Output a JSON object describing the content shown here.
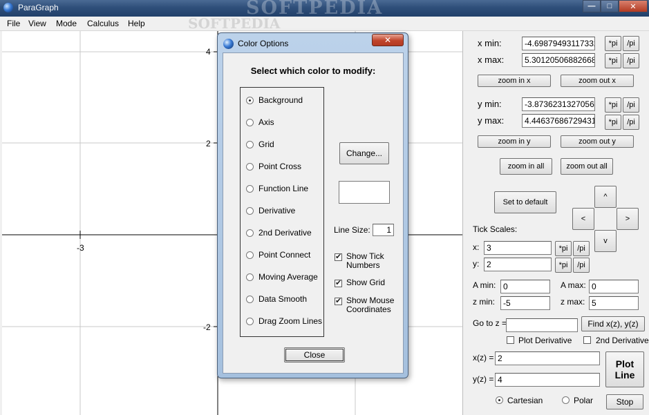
{
  "window": {
    "title": "ParaGraph",
    "watermark": "SOFTPEDIA",
    "controls": {
      "minimize": "—",
      "maximize": "□",
      "close": "✕"
    }
  },
  "menu": [
    "File",
    "View",
    "Mode",
    "Calculus",
    "Help"
  ],
  "menu_watermark": "SOFTPEDIA",
  "graph": {
    "x_tick_labels": [
      "-3"
    ],
    "y_tick_labels": [
      "4",
      "2",
      "-2"
    ]
  },
  "panel": {
    "xmin_label": "x min:",
    "xmin_value": "-4.69879493117332",
    "xmax_label": "x max:",
    "xmax_value": "5.30120506882668",
    "ymin_label": "y min:",
    "ymin_value": "-3.87362313270569",
    "ymax_label": "y max:",
    "ymax_value": "4.44637686729431",
    "times_pi": "*pi",
    "div_pi": "/pi",
    "zoom_in_x": "zoom in x",
    "zoom_out_x": "zoom out x",
    "zoom_in_y": "zoom in y",
    "zoom_out_y": "zoom out y",
    "zoom_in_all": "zoom in all",
    "zoom_out_all": "zoom out all",
    "set_default": "Set to default",
    "arrow_up": "^",
    "arrow_left": "<",
    "arrow_right": ">",
    "arrow_down": "v",
    "tick_scales_label": "Tick Scales:",
    "tick_x_label": "x:",
    "tick_x_value": "3",
    "tick_y_label": "y:",
    "tick_y_value": "2",
    "amin_label": "A min:",
    "amin_value": "0",
    "amax_label": "A max:",
    "amax_value": "0",
    "zmin_label": "z min:",
    "zmin_value": "-5",
    "zmax_label": "z max:",
    "zmax_value": "5",
    "goto_label": "Go to z =",
    "goto_value": "",
    "find_button": "Find x(z), y(z)",
    "plot_derivative": "Plot Derivative",
    "second_derivative": "2nd Derivative",
    "xz_label": "x(z) =",
    "xz_value": "2",
    "yz_label": "y(z) =",
    "yz_value": "4",
    "plot_line_1": "Plot",
    "plot_line_2": "Line",
    "cartesian": "Cartesian",
    "polar": "Polar",
    "stop": "Stop"
  },
  "dialog": {
    "title": "Color Options",
    "close_x": "✕",
    "heading": "Select which color to modify:",
    "options": [
      "Background",
      "Axis",
      "Grid",
      "Point Cross",
      "Function Line",
      "Derivative",
      "2nd Derivative",
      "Point Connect",
      "Moving Average",
      "Data Smooth",
      "Drag Zoom Lines"
    ],
    "selected_option": "Background",
    "change_button": "Change...",
    "line_size_label": "Line Size:",
    "line_size_value": "1",
    "show_tick_numbers_1": "Show Tick",
    "show_tick_numbers_2": "Numbers",
    "show_grid": "Show Grid",
    "show_mouse_1": "Show Mouse",
    "show_mouse_2": "Coordinates",
    "close_button": "Close"
  }
}
